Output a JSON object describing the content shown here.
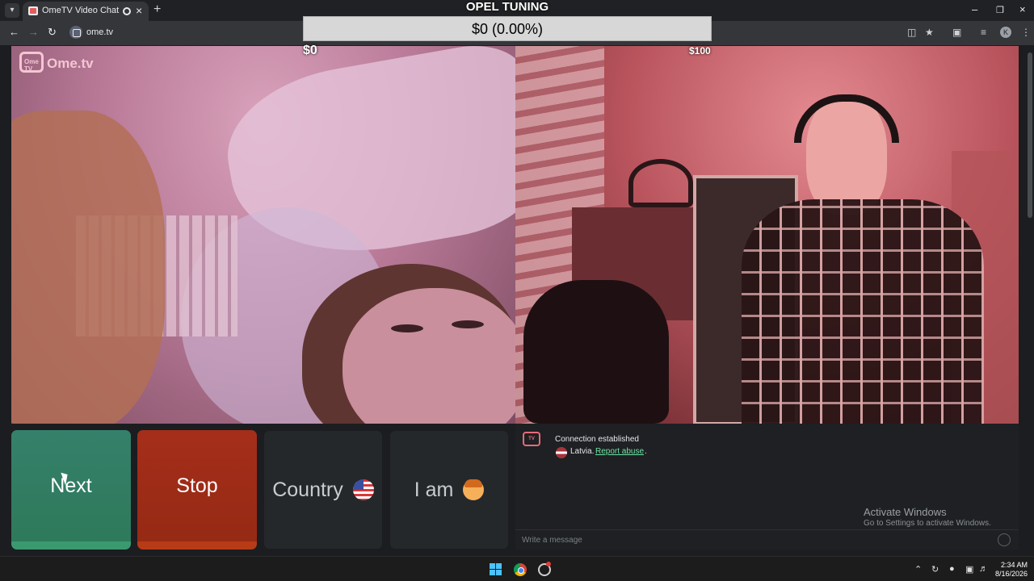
{
  "browser": {
    "tab_title": "OmeTV Video Chat — Ome",
    "url": "ome.tv"
  },
  "overlay": {
    "title": "OPEL TUNING",
    "progress_text": "$0 (0.00%)",
    "progress_fraction": 0,
    "min_label": "$0",
    "max_label": "$100"
  },
  "site": {
    "logo": "Ome.tv",
    "logo_badge": "Ome TV"
  },
  "controls": {
    "next": "Next",
    "stop": "Stop",
    "country": "Country",
    "iam": "I am"
  },
  "chat": {
    "status": "Connection established",
    "country": "Latvia.",
    "report": "Report abuse",
    "report_suffix": ".",
    "placeholder": "Write a message"
  },
  "watermark": {
    "line1": "Activate Windows",
    "line2": "Go to Settings to activate Windows."
  },
  "taskbar": {
    "time": "2:34 AM",
    "date": "8/16/2026"
  },
  "colors": {
    "next_green": "#2e7a5b",
    "stop_red": "#962a14",
    "link_green": "#6fe3a4"
  }
}
